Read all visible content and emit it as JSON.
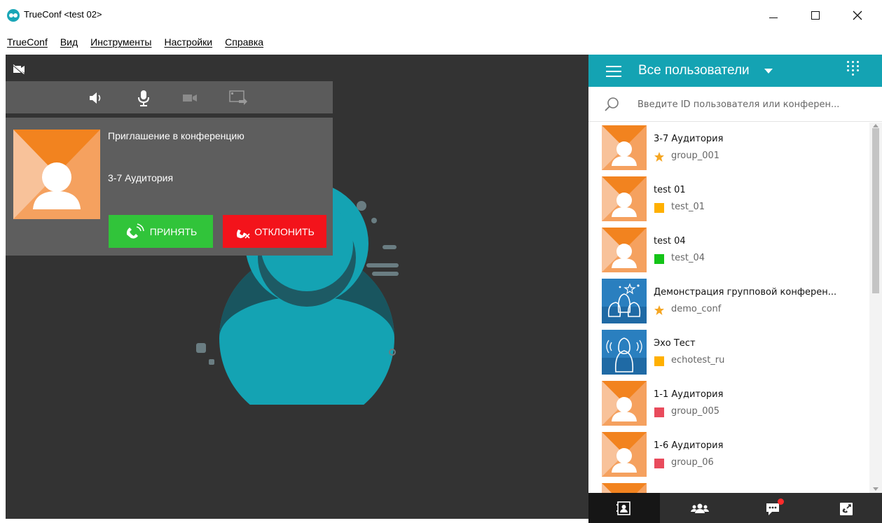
{
  "window": {
    "title": "TrueConf <test 02>",
    "icon": "trueconf-logo-icon"
  },
  "menu": [
    "TrueConf",
    "Вид",
    "Инструменты",
    "Настройки",
    "Справка"
  ],
  "video": {
    "camera_state_icon": "camera-off-icon",
    "controls": [
      "speaker-icon",
      "microphone-icon",
      "camera-icon",
      "screen-share-icon"
    ]
  },
  "incoming_call": {
    "title": "Приглашение в конференцию",
    "caller": "3-7 Аудитория",
    "accept_label": "ПРИНЯТЬ",
    "reject_label": "ОТКЛОНИТЬ",
    "accept_color": "#31c43a",
    "reject_color": "#f3131b"
  },
  "panel": {
    "filter_label": "Все пользователи",
    "search_placeholder": "Введите ID пользователя или конферен...",
    "accent_color": "#14a3b3",
    "contacts": [
      {
        "name": "3-7 Аудитория",
        "id": "group_001",
        "status": "star",
        "color": "#f5a623",
        "avatar": "user-avatar"
      },
      {
        "name": "test 01",
        "id": "test_01",
        "status": "square",
        "color": "#ffb000",
        "avatar": "user-avatar"
      },
      {
        "name": "test 04",
        "id": "test_04",
        "status": "square",
        "color": "#14c418",
        "avatar": "user-avatar"
      },
      {
        "name": "Демонстрация групповой конферен...",
        "id": "demo_conf",
        "status": "star",
        "color": "#f5a623",
        "avatar": "group-avatar"
      },
      {
        "name": "Эхо Тест",
        "id": "echotest_ru",
        "status": "square",
        "color": "#ffb000",
        "avatar": "echo-avatar"
      },
      {
        "name": "1-1 Аудитория",
        "id": "group_005",
        "status": "square",
        "color": "#e94b5c",
        "avatar": "user-avatar"
      },
      {
        "name": "1-6 Аудитория",
        "id": "group_06",
        "status": "square",
        "color": "#e94b5c",
        "avatar": "user-avatar"
      }
    ],
    "nav_tabs": [
      "contacts-tab-icon",
      "conferences-tab-icon",
      "chat-tab-icon",
      "calls-tab-icon"
    ]
  }
}
